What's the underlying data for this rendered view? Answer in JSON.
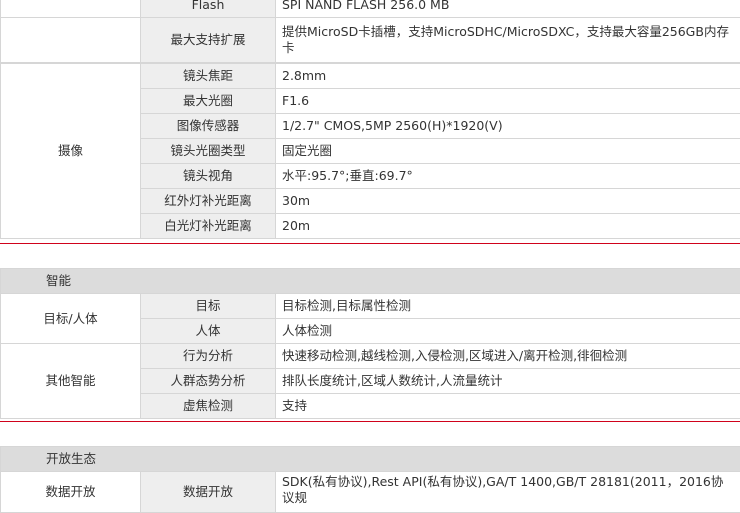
{
  "storage": {
    "rows": [
      {
        "label": "Flash",
        "value": "SPI NAND FLASH 256.0 MB"
      },
      {
        "label": "最大支持扩展",
        "value": "提供MicroSD卡插槽，支持MicroSDHC/MicroSDXC，支持最大容量256GB内存卡"
      }
    ]
  },
  "camera": {
    "category": "摄像",
    "rows": [
      {
        "label": "镜头焦距",
        "value": "2.8mm"
      },
      {
        "label": "最大光圈",
        "value": "F1.6"
      },
      {
        "label": "图像传感器",
        "value": "1/2.7\" CMOS,5MP 2560(H)*1920(V)"
      },
      {
        "label": "镜头光圈类型",
        "value": "固定光圈"
      },
      {
        "label": "镜头视角",
        "value": "水平:95.7°;垂直:69.7°"
      },
      {
        "label": "红外灯补光距离",
        "value": "30m"
      },
      {
        "label": "白光灯补光距离",
        "value": "20m"
      }
    ]
  },
  "smart": {
    "heading": "智能",
    "group1": {
      "category": "目标/人体",
      "rows": [
        {
          "label": "目标",
          "value": "目标检测,目标属性检测"
        },
        {
          "label": "人体",
          "value": "人体检测"
        }
      ]
    },
    "group2": {
      "category": "其他智能",
      "rows": [
        {
          "label": "行为分析",
          "value": "快速移动检测,越线检测,入侵检测,区域进入/离开检测,徘徊检测"
        },
        {
          "label": "人群态势分析",
          "value": "排队长度统计,区域人数统计,人流量统计"
        },
        {
          "label": "虚焦检测",
          "value": "支持"
        }
      ]
    }
  },
  "open": {
    "heading": "开放生态",
    "row": {
      "category": "数据开放",
      "label": "数据开放",
      "value": "SDK(私有协议),Rest API(私有协议),GA/T 1400,GB/T 28181(2011，2016协议规"
    }
  }
}
